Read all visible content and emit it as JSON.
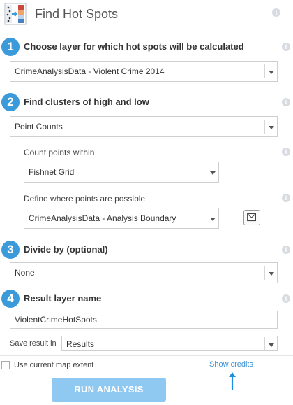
{
  "header": {
    "title": "Find Hot Spots"
  },
  "steps": [
    {
      "number": "1",
      "label": "Choose layer for which hot spots will be calculated",
      "selected": "CrimeAnalysisData - Violent Crime 2014"
    },
    {
      "number": "2",
      "label": "Find clusters of high and low",
      "selected": "Point Counts",
      "count_within_label": "Count points within",
      "count_within_selected": "Fishnet Grid",
      "define_where_label": "Define where points are possible",
      "define_where_selected": "CrimeAnalysisData - Analysis Boundary"
    },
    {
      "number": "3",
      "label": "Divide by (optional)",
      "selected": "None"
    },
    {
      "number": "4",
      "label": "Result layer name",
      "value": "ViolentCrimeHotSpots",
      "save_in_label": "Save result in",
      "save_in_selected": "Results"
    }
  ],
  "footer": {
    "use_extent_label": "Use current map extent",
    "show_credits": "Show credits",
    "run_label": "RUN ANALYSIS"
  },
  "icons": {
    "tool": "hot-spots-tool-icon",
    "info": "info-icon",
    "browse": "browse-layer-icon"
  },
  "colors": {
    "accent": "#3b9ad9",
    "button": "#8fc8f0",
    "link": "#3b8fd4"
  }
}
